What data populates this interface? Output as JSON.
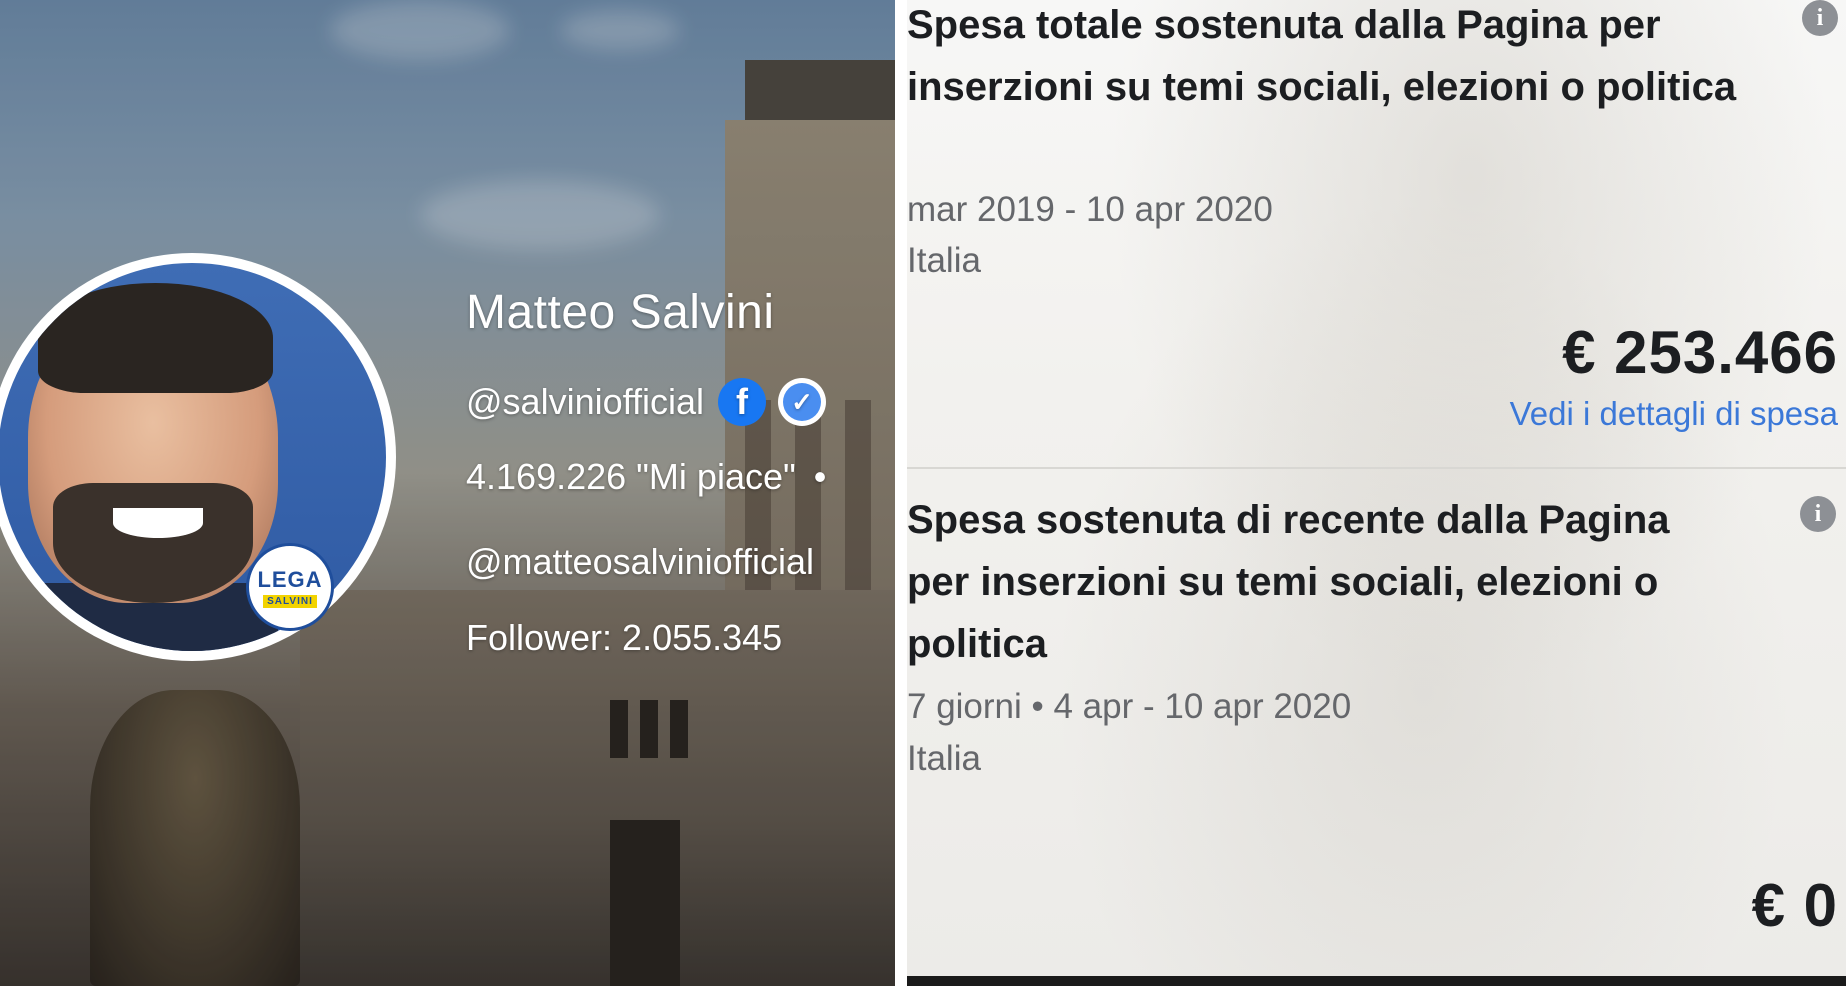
{
  "profile": {
    "name": "Matteo Salvini",
    "handle": "@salviniofficial",
    "likes": "4.169.226 \"Mi piace\"",
    "likes_separator": "•",
    "instagram_handle": "@matteosalviniofficial",
    "followers": "Follower: 2.055.345",
    "badge_text": "LEGA",
    "badge_sub": "SALVINI",
    "icons": [
      "facebook-icon",
      "verified-badge-icon"
    ]
  },
  "spending": [
    {
      "title": "Spesa totale sostenuta dalla Pagina per inserzioni su temi sociali, elezioni o politica",
      "period": "mar 2019 - 10 apr 2020",
      "country": "Italia",
      "amount": "€ 253.466",
      "link": "Vedi i dettagli di spesa"
    },
    {
      "title": "Spesa sostenuta di recente dalla Pagina per inserzioni su temi sociali, elezioni o politica",
      "period": "7 giorni • 4 apr - 10 apr 2020",
      "country": "Italia",
      "amount": "€ 0"
    }
  ],
  "colors": {
    "facebook_blue": "#1877f2",
    "link_blue": "#3b78d8",
    "info_gray": "#8d9095"
  }
}
